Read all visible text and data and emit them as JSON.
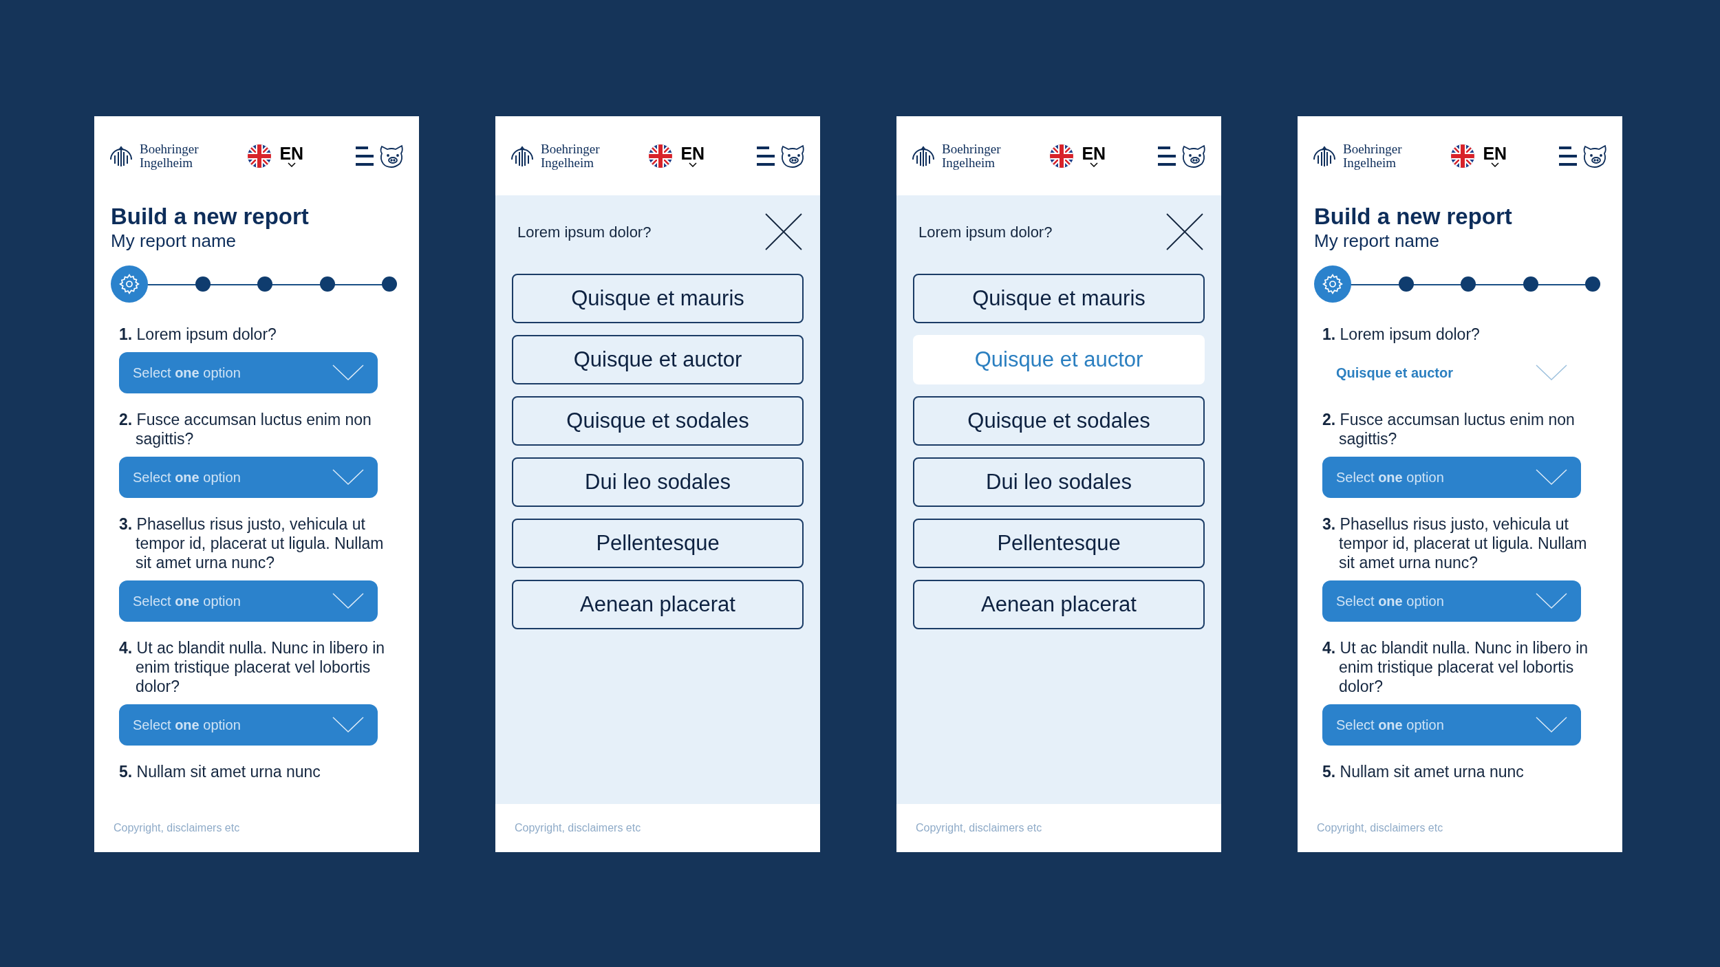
{
  "screens": [
    {
      "kind": "form",
      "header": {
        "logo": [
          "Boehringer",
          "Ingelheim"
        ],
        "language": "EN"
      },
      "title": "Build a new report",
      "subtitle": "My report name",
      "steps": [
        {
          "current": true
        },
        {
          "current": false
        },
        {
          "current": false
        },
        {
          "current": false
        },
        {
          "current": false
        }
      ],
      "questions": [
        {
          "text": "**1.** Lorem ipsum dolor?",
          "select": {
            "placeholder": "Select **one** option"
          }
        },
        {
          "text": "**2.** Fusce accumsan luctus enim non sagittis?",
          "select": {
            "placeholder": "Select **one** option"
          }
        },
        {
          "text": "**3.** Phasellus risus justo, vehicula ut tempor id, placerat ut ligula. Nullam sit amet urna nunc?",
          "select": {
            "placeholder": "Select **one** option"
          }
        },
        {
          "text": "**4.** Ut ac blandit nulla. Nunc in libero in enim tristique placerat vel lobortis dolor?",
          "select": {
            "placeholder": "Select **one** option"
          }
        },
        {
          "text": "**5.** Nullam sit amet urna nunc"
        }
      ],
      "footer": "Copyright, disclaimers etc"
    },
    {
      "kind": "picker",
      "header": {
        "logo": [
          "Boehringer",
          "Ingelheim"
        ],
        "language": "EN"
      },
      "question": "Lorem ipsum dolor?",
      "options": [
        {
          "label": "Quisque et mauris",
          "selected": false
        },
        {
          "label": "Quisque et auctor",
          "selected": false
        },
        {
          "label": "Quisque et sodales",
          "selected": false
        },
        {
          "label": "Dui leo sodales",
          "selected": false
        },
        {
          "label": "Pellentesque",
          "selected": false
        },
        {
          "label": "Aenean placerat",
          "selected": false
        }
      ],
      "footer": "Copyright, disclaimers etc"
    },
    {
      "kind": "picker",
      "header": {
        "logo": [
          "Boehringer",
          "Ingelheim"
        ],
        "language": "EN"
      },
      "question": "Lorem ipsum dolor?",
      "options": [
        {
          "label": "Quisque et mauris",
          "selected": false
        },
        {
          "label": "Quisque et auctor",
          "selected": true
        },
        {
          "label": "Quisque et sodales",
          "selected": false
        },
        {
          "label": "Dui leo sodales",
          "selected": false
        },
        {
          "label": "Pellentesque",
          "selected": false
        },
        {
          "label": "Aenean placerat",
          "selected": false
        }
      ],
      "footer": "Copyright, disclaimers etc"
    },
    {
      "kind": "form",
      "header": {
        "logo": [
          "Boehringer",
          "Ingelheim"
        ],
        "language": "EN"
      },
      "title": "Build a new report",
      "subtitle": "My report name",
      "steps": [
        {
          "current": true
        },
        {
          "current": false
        },
        {
          "current": false
        },
        {
          "current": false
        },
        {
          "current": false
        }
      ],
      "questions": [
        {
          "text": "**1.** Lorem ipsum dolor?",
          "select": {
            "value": "Quisque et auctor"
          }
        },
        {
          "text": "**2.** Fusce accumsan luctus enim non sagittis?",
          "select": {
            "placeholder": "Select **one** option"
          }
        },
        {
          "text": "**3.** Phasellus risus justo, vehicula ut tempor id, placerat ut ligula. Nullam sit amet urna nunc?",
          "select": {
            "placeholder": "Select **one** option"
          }
        },
        {
          "text": "**4.** Ut ac blandit nulla. Nunc in libero in enim tristique placerat vel lobortis dolor?",
          "select": {
            "placeholder": "Select **one** option"
          }
        },
        {
          "text": "**5.** Nullam sit amet urna nunc"
        }
      ],
      "footer": "Copyright, disclaimers etc"
    }
  ]
}
